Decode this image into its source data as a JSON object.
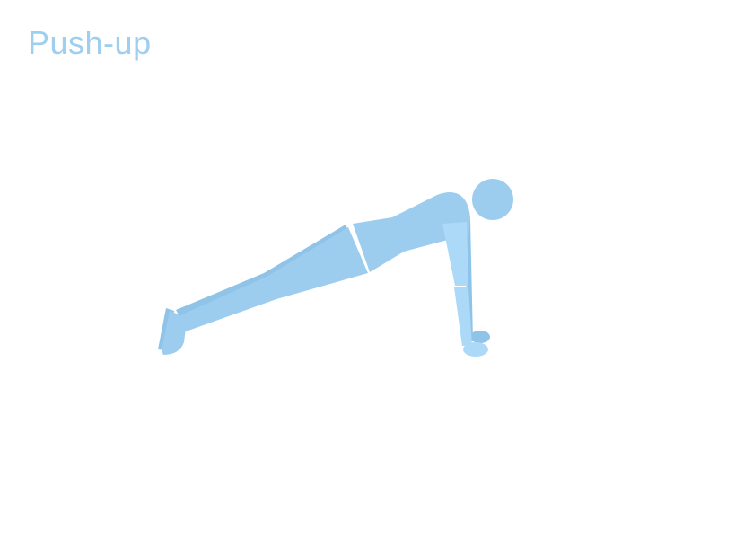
{
  "title": "Push-up",
  "colors": {
    "body": "#9dcdee",
    "body_dark": "#8fc3e8",
    "body_light": "#acd9f7",
    "title": "#9fcfef"
  }
}
